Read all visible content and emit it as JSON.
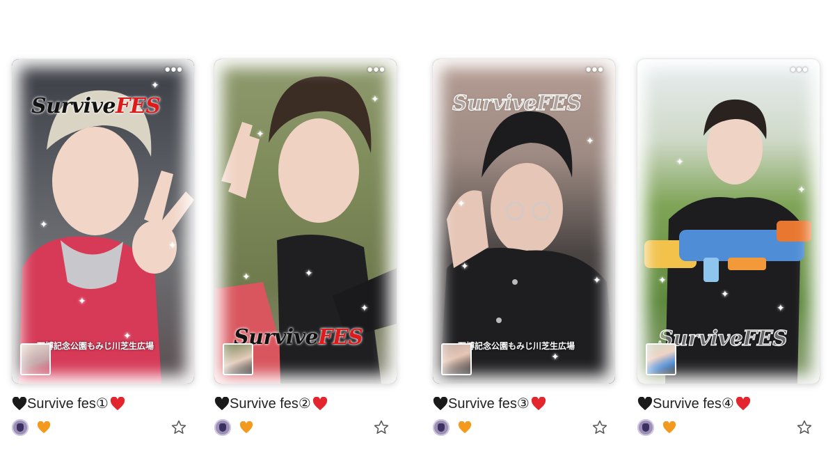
{
  "cards": [
    {
      "title": "Survive fes①",
      "logo": {
        "word1": "Survive",
        "word2": "FES"
      },
      "location": "万博記念公園もみじ川芝生広場",
      "menu_icon": "more-dots-icon",
      "favorite_icon": "star-outline-icon",
      "like_icon": "orange-heart-icon"
    },
    {
      "title": "Survive fes②",
      "logo": {
        "word1": "Survive",
        "word2": "FES"
      },
      "location": "",
      "menu_icon": "more-dots-icon",
      "favorite_icon": "star-outline-icon",
      "like_icon": "orange-heart-icon"
    },
    {
      "title": "Survive fes③",
      "logo": {
        "word1": "Survive",
        "word2": "FES"
      },
      "location": "万博記念公園もみじ川芝生広場",
      "menu_icon": "more-dots-icon",
      "favorite_icon": "star-outline-icon",
      "like_icon": "orange-heart-icon"
    },
    {
      "title": "Survive fes④",
      "logo": {
        "word1": "Survive",
        "word2": "FES"
      },
      "location": "",
      "menu_icon": "more-dots-icon",
      "favorite_icon": "star-outline-icon",
      "like_icon": "orange-heart-icon"
    }
  ],
  "menu_glyph": "•••",
  "colors": {
    "heart_black": "#1a1a1a",
    "heart_red": "#e3262d",
    "heart_orange": "#f39a1e",
    "logo_red": "#e01a1a"
  }
}
